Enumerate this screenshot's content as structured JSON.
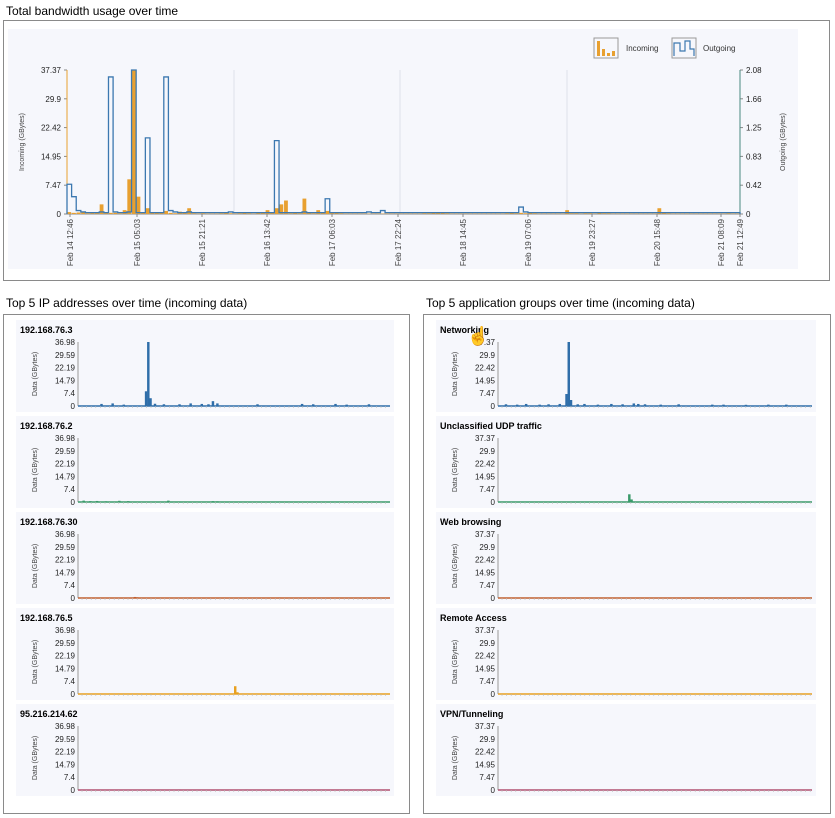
{
  "sections": {
    "main_title": "Total bandwidth usage over time",
    "ip_title": "Top 5 IP addresses over time (incoming data)",
    "app_title": "Top 5 application groups over time (incoming data)"
  },
  "colors": {
    "incoming": "#e8a030",
    "outgoing": "#3c78b0",
    "plot_bg": "#f6f7fc",
    "panel_border": "#8a8a8a"
  },
  "cursor_icon": "hand-pointer-icon",
  "chart_data": [
    {
      "id": "main",
      "type": "bar",
      "title": "Total bandwidth usage over time",
      "ylabel": "Incoming (GBytes)",
      "y2label": "Outgoing (GBytes)",
      "ylim": [
        0,
        37.37
      ],
      "y2lim": [
        0,
        2.08
      ],
      "yticks": [
        "0",
        "7.47",
        "14.95",
        "22.42",
        "29.9",
        "37.37"
      ],
      "y2ticks": [
        "0",
        "0.42",
        "0.83",
        "1.25",
        "1.66",
        "2.08"
      ],
      "xticks": [
        "Feb 14 12:46",
        "Feb 15 05:03",
        "Feb 15 21:21",
        "Feb 16 13:42",
        "Feb 17 06:03",
        "Feb 17 22:24",
        "Feb 18 14:45",
        "Feb 19 07:06",
        "Feb 19 23:27",
        "Feb 20 15:48",
        "Feb 21 08:09",
        "Feb 21 12:49"
      ],
      "legend": [
        {
          "label": "Incoming",
          "icon": "incoming-bar-legend-icon"
        },
        {
          "label": "Outgoing",
          "icon": "outgoing-step-legend-icon"
        }
      ],
      "legend_position": "top-right",
      "series": [
        {
          "name": "Incoming",
          "axis": "left",
          "values": [
            0.5,
            0.3,
            0.4,
            0.6,
            0.2,
            0.3,
            0.4,
            2.5,
            0.4,
            0.3,
            0.3,
            0.2,
            1.0,
            9.0,
            37.37,
            4.5,
            0.5,
            1.5,
            0.4,
            0.3,
            0.5,
            0.8,
            0.3,
            0.2,
            0.6,
            0.3,
            1.5,
            0.2,
            0.1,
            0.2,
            0.1,
            0.1,
            0.1,
            0.2,
            0.4,
            0.2,
            0.1,
            0.2,
            0.3,
            0.2,
            0.1,
            0.3,
            0.5,
            1.0,
            0.4,
            1.5,
            2.5,
            3.5,
            0.2,
            0.3,
            0.2,
            4.0,
            0.3,
            0.2,
            1.0,
            0.3,
            0.8,
            0.5,
            0.3,
            0.2,
            0.1,
            0.1,
            0.1,
            0.1,
            0.1,
            0.1,
            0.1,
            0.1,
            0.1,
            0.1,
            0.1,
            0.1,
            0.1,
            0.1,
            0.1,
            0.1,
            0.1,
            0.2,
            0.2,
            0.3,
            0.4,
            0.3,
            0.2,
            0.1,
            0.1,
            0.1,
            0.1,
            0.1,
            0.1,
            0.1,
            0.1,
            0.1,
            0.1,
            0.1,
            0.1,
            0.2,
            0.3,
            0.2,
            0.3,
            0.2,
            0.4,
            0.2,
            0.1,
            0.1,
            0.1,
            0.1,
            0.1,
            0.1,
            1.0,
            0.2,
            0.2,
            0.1,
            0.2,
            0.2,
            0.1,
            0.3,
            0.2,
            0.2,
            0.1,
            0.1,
            0.1,
            0.1,
            0.1,
            0.1,
            0.1,
            0.1,
            0.1,
            0.1,
            1.5,
            0.3,
            0.2,
            0.1,
            0.1,
            0.1,
            0.1,
            0.1,
            0.1,
            0.1,
            0.1,
            0.1,
            0.1,
            0.1,
            0.1,
            0.2,
            0.1,
            0.1
          ]
        },
        {
          "name": "Outgoing",
          "axis": "right",
          "values": [
            0.43,
            0.25,
            0.05,
            0.03,
            0.02,
            0.02,
            0.02,
            0.03,
            0.02,
            1.98,
            0.03,
            0.02,
            0.02,
            0.03,
            2.08,
            0.02,
            0.02,
            1.1,
            0.02,
            0.02,
            0.02,
            1.98,
            0.05,
            0.03,
            0.02,
            0.02,
            0.03,
            0.02,
            0.02,
            0.02,
            0.02,
            0.02,
            0.02,
            0.02,
            0.02,
            0.03,
            0.02,
            0.02,
            0.02,
            0.02,
            0.02,
            0.02,
            0.02,
            0.02,
            0.02,
            1.06,
            0.02,
            0.02,
            0.02,
            0.02,
            0.02,
            0.03,
            0.02,
            0.02,
            0.02,
            0.02,
            0.22,
            0.02,
            0.02,
            0.02,
            0.02,
            0.02,
            0.02,
            0.02,
            0.02,
            0.03,
            0.02,
            0.02,
            0.05,
            0.02,
            0.02,
            0.02,
            0.02,
            0.02,
            0.02,
            0.02,
            0.02,
            0.02,
            0.02,
            0.02,
            0.02,
            0.02,
            0.02,
            0.02,
            0.02,
            0.02,
            0.02,
            0.02,
            0.02,
            0.02,
            0.02,
            0.02,
            0.02,
            0.02,
            0.02,
            0.02,
            0.02,
            0.02,
            0.1,
            0.03,
            0.02,
            0.02,
            0.02,
            0.02,
            0.02,
            0.02,
            0.02,
            0.02,
            0.02,
            0.02,
            0.02,
            0.02,
            0.02,
            0.02,
            0.02,
            0.02,
            0.02,
            0.02,
            0.02,
            0.02,
            0.02,
            0.02,
            0.02,
            0.02,
            0.02,
            0.02,
            0.02,
            0.02,
            0.02,
            0.02,
            0.02,
            0.02,
            0.02,
            0.02,
            0.02,
            0.02,
            0.02,
            0.02,
            0.02,
            0.02,
            0.02,
            0.02,
            0.02,
            0.02,
            0.02,
            0.02
          ]
        }
      ]
    },
    {
      "id": "ip",
      "type": "bar",
      "title": "Top 5 IP addresses over time (incoming data)",
      "ylabel": "Data (GBytes)",
      "panels": [
        {
          "name": "192.168.76.3",
          "color": "#2f6ea9",
          "yticks": [
            "0",
            "7.4",
            "14.79",
            "22.19",
            "29.59",
            "36.98"
          ],
          "ymax": 36.98,
          "spikes": [
            [
              10,
              1.2
            ],
            [
              15,
              1.5
            ],
            [
              20,
              0.8
            ],
            [
              30,
              8.5
            ],
            [
              31,
              36.98
            ],
            [
              32,
              4.5
            ],
            [
              34,
              1.3
            ],
            [
              38,
              1.0
            ],
            [
              45,
              1.0
            ],
            [
              50,
              1.5
            ],
            [
              55,
              1.2
            ],
            [
              58,
              1.0
            ],
            [
              60,
              2.8
            ],
            [
              62,
              1.5
            ],
            [
              80,
              1.0
            ],
            [
              100,
              1.2
            ],
            [
              105,
              1.0
            ],
            [
              115,
              1.2
            ],
            [
              120,
              0.8
            ],
            [
              130,
              1.0
            ]
          ]
        },
        {
          "name": "192.168.76.2",
          "color": "#3a9a6a",
          "yticks": [
            "0",
            "7.4",
            "14.79",
            "22.19",
            "29.59",
            "36.98"
          ],
          "ymax": 36.98,
          "spikes": [
            [
              2,
              0.8
            ],
            [
              5,
              0.5
            ],
            [
              8,
              0.6
            ],
            [
              12,
              0.4
            ],
            [
              18,
              0.7
            ],
            [
              22,
              0.5
            ],
            [
              40,
              0.8
            ],
            [
              45,
              0.3
            ],
            [
              60,
              0.5
            ],
            [
              62,
              0.4
            ],
            [
              90,
              0.3
            ]
          ]
        },
        {
          "name": "192.168.76.30",
          "color": "#c06030",
          "yticks": [
            "0",
            "7.4",
            "14.79",
            "22.19",
            "29.59",
            "36.98"
          ],
          "ymax": 36.98,
          "spikes": [
            [
              25,
              0.6
            ],
            [
              26,
              0.4
            ],
            [
              50,
              0.3
            ],
            [
              65,
              0.3
            ],
            [
              90,
              0.3
            ]
          ]
        },
        {
          "name": "192.168.76.5",
          "color": "#e8a020",
          "yticks": [
            "0",
            "7.4",
            "14.79",
            "22.19",
            "29.59",
            "36.98"
          ],
          "ymax": 36.98,
          "spikes": [
            [
              70,
              4.5
            ],
            [
              71,
              1.0
            ]
          ]
        },
        {
          "name": "95.216.214.62",
          "color": "#b05070",
          "yticks": [
            "0",
            "7.4",
            "14.79",
            "22.19",
            "29.59",
            "36.98"
          ],
          "ymax": 36.98,
          "spikes": [
            [
              45,
              0.3
            ],
            [
              75,
              0.3
            ]
          ]
        }
      ]
    },
    {
      "id": "app",
      "type": "bar",
      "title": "Top 5 application groups over time (incoming data)",
      "ylabel": "Data (GBytes)",
      "panels": [
        {
          "name": "Networking",
          "color": "#2f6ea9",
          "yticks": [
            "0",
            "7.47",
            "14.95",
            "22.42",
            "29.9",
            "37.37"
          ],
          "ymax": 37.37,
          "spikes": [
            [
              3,
              1.0
            ],
            [
              8,
              0.8
            ],
            [
              12,
              1.2
            ],
            [
              18,
              0.8
            ],
            [
              22,
              1.0
            ],
            [
              27,
              1.2
            ],
            [
              30,
              7.0
            ],
            [
              31,
              37.37
            ],
            [
              32,
              3.5
            ],
            [
              35,
              1.0
            ],
            [
              38,
              1.2
            ],
            [
              44,
              0.8
            ],
            [
              50,
              1.2
            ],
            [
              55,
              1.0
            ],
            [
              60,
              1.5
            ],
            [
              62,
              1.2
            ],
            [
              65,
              1.0
            ],
            [
              72,
              0.8
            ],
            [
              80,
              1.0
            ],
            [
              95,
              0.8
            ],
            [
              100,
              0.8
            ],
            [
              110,
              0.7
            ],
            [
              120,
              0.8
            ],
            [
              128,
              0.8
            ]
          ]
        },
        {
          "name": "Unclassified UDP traffic",
          "color": "#3a9a6a",
          "yticks": [
            "0",
            "7.47",
            "14.95",
            "22.42",
            "29.9",
            "37.37"
          ],
          "ymax": 37.37,
          "spikes": [
            [
              58,
              4.5
            ],
            [
              59,
              1.5
            ]
          ]
        },
        {
          "name": "Web browsing",
          "color": "#c06030",
          "yticks": [
            "0",
            "7.47",
            "14.95",
            "22.42",
            "29.9",
            "37.37"
          ],
          "ymax": 37.37,
          "spikes": [
            [
              20,
              0.2
            ],
            [
              80,
              0.2
            ]
          ]
        },
        {
          "name": "Remote Access",
          "color": "#e8a020",
          "yticks": [
            "0",
            "7.47",
            "14.95",
            "22.42",
            "29.9",
            "37.37"
          ],
          "ymax": 37.37,
          "spikes": [
            [
              40,
              0.2
            ]
          ]
        },
        {
          "name": "VPN/Tunneling",
          "color": "#b05070",
          "yticks": [
            "0",
            "7.47",
            "14.95",
            "22.42",
            "29.9",
            "37.37"
          ],
          "ymax": 37.37,
          "spikes": [
            [
              60,
              0.2
            ]
          ]
        }
      ]
    }
  ]
}
